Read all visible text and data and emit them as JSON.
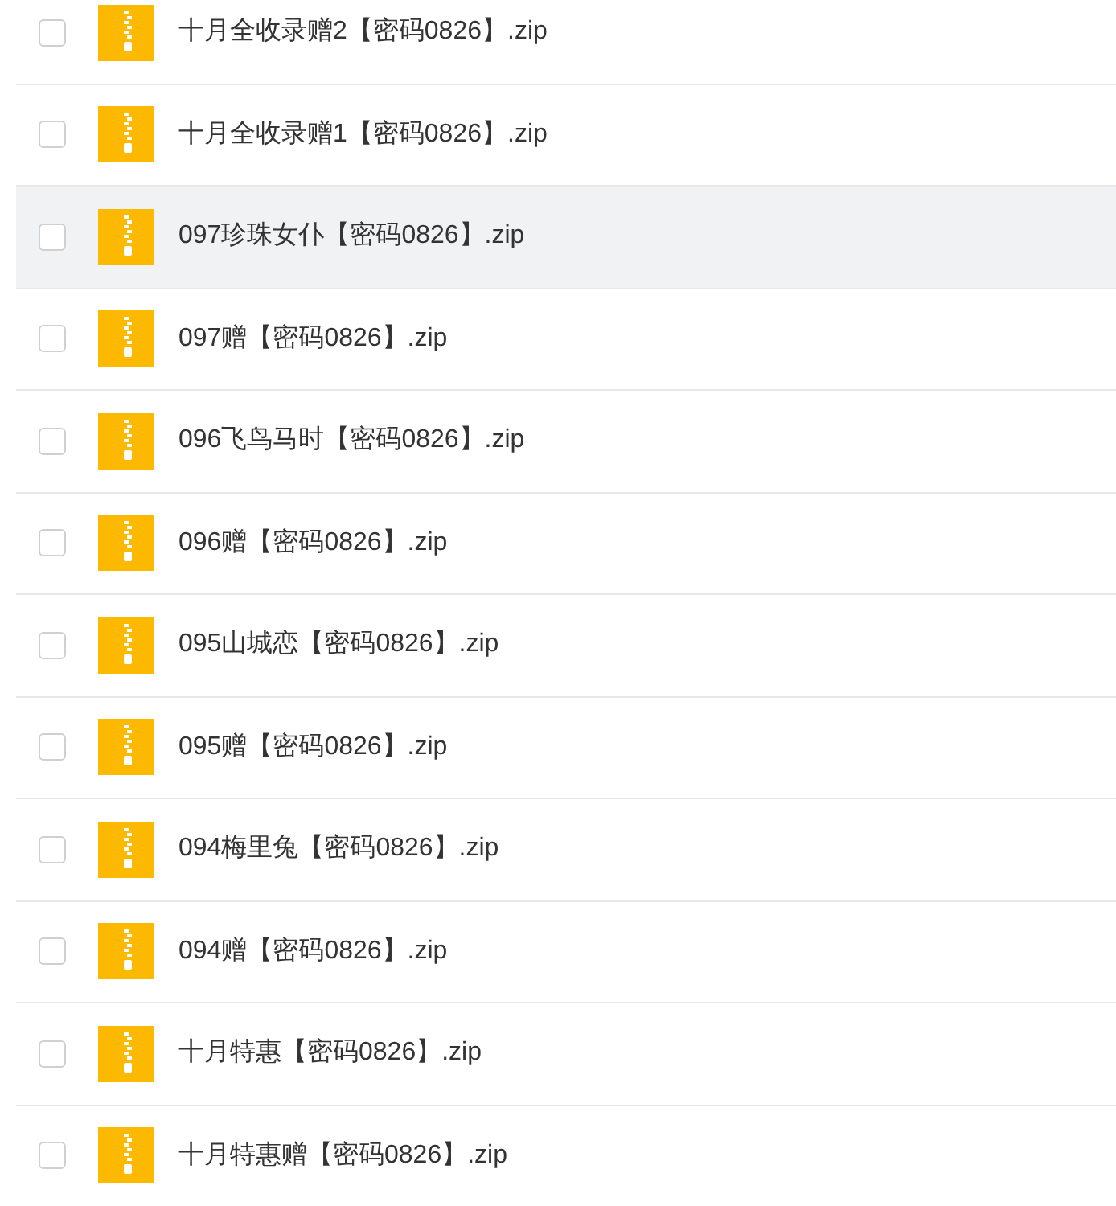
{
  "files": [
    {
      "name": "十月全收录赠2【密码0826】.zip",
      "checked": false,
      "highlighted": false
    },
    {
      "name": "十月全收录赠1【密码0826】.zip",
      "checked": false,
      "highlighted": false
    },
    {
      "name": "097珍珠女仆【密码0826】.zip",
      "checked": false,
      "highlighted": true
    },
    {
      "name": "097赠【密码0826】.zip",
      "checked": false,
      "highlighted": false
    },
    {
      "name": "096飞鸟马时【密码0826】.zip",
      "checked": false,
      "highlighted": false
    },
    {
      "name": "096赠【密码0826】.zip",
      "checked": false,
      "highlighted": false
    },
    {
      "name": "095山城恋【密码0826】.zip",
      "checked": false,
      "highlighted": false
    },
    {
      "name": "095赠【密码0826】.zip",
      "checked": false,
      "highlighted": false
    },
    {
      "name": "094梅里兔【密码0826】.zip",
      "checked": false,
      "highlighted": false
    },
    {
      "name": "094赠【密码0826】.zip",
      "checked": false,
      "highlighted": false
    },
    {
      "name": "十月特惠【密码0826】.zip",
      "checked": false,
      "highlighted": false
    },
    {
      "name": "十月特惠赠【密码0826】.zip",
      "checked": false,
      "highlighted": false
    }
  ]
}
